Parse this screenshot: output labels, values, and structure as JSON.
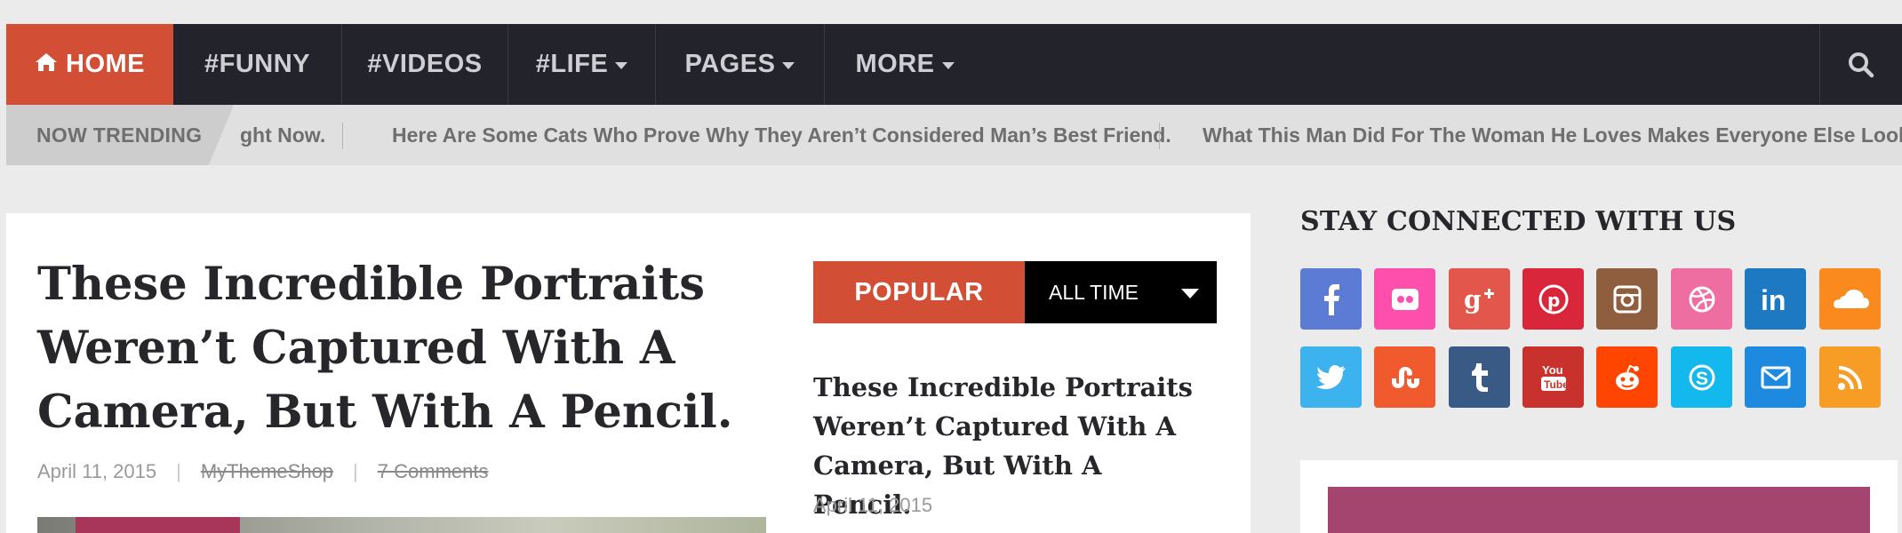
{
  "nav": {
    "home_label": "HOME",
    "items": [
      {
        "label": "#FUNNY",
        "has_caret": false
      },
      {
        "label": "#VIDEOS",
        "has_caret": false
      },
      {
        "label": "#LIFE",
        "has_caret": true
      },
      {
        "label": "PAGES",
        "has_caret": true
      },
      {
        "label": "MORE",
        "has_caret": true
      }
    ],
    "search_icon": "search-icon",
    "accent_color": "#d24e35",
    "bg_color": "#23232b"
  },
  "trending": {
    "label": "NOW TRENDING",
    "items": [
      "ght Now.",
      "Here Are Some Cats Who Prove Why They Aren’t Considered Man’s Best Friend.",
      "What This Man Did For The Woman He Loves Makes Everyone Else Look Ba"
    ]
  },
  "article": {
    "title": "These Incredible Portraits Weren’t Captured With A Camera, But With A Pencil.",
    "date": "April 11, 2015",
    "author": "MyThemeShop",
    "comments": "7 Comments"
  },
  "popular": {
    "tab_label": "POPULAR",
    "select_value": "ALL TIME",
    "post_title": "These Incredible Portraits Weren’t Captured With A Camera, But With A Pencil.",
    "post_date": "April 11, 2015"
  },
  "sidebar": {
    "heading": "STAY CONNECTED WITH US",
    "social": [
      {
        "name": "facebook-icon",
        "color": "#5b7bd5"
      },
      {
        "name": "flickr-icon",
        "color": "#ff4fad"
      },
      {
        "name": "google-plus-icon",
        "color": "#e2564b"
      },
      {
        "name": "pinterest-icon",
        "color": "#d9263a"
      },
      {
        "name": "instagram-icon",
        "color": "#8e5e3f"
      },
      {
        "name": "dribbble-icon",
        "color": "#ef6ea1"
      },
      {
        "name": "linkedin-icon",
        "color": "#1c79c2"
      },
      {
        "name": "soundcloud-icon",
        "color": "#fb8a1e"
      },
      {
        "name": "twitter-icon",
        "color": "#3cb3ee"
      },
      {
        "name": "stumbleupon-icon",
        "color": "#f05a2d"
      },
      {
        "name": "tumblr-icon",
        "color": "#3a5a86"
      },
      {
        "name": "youtube-icon",
        "color": "#c8312c"
      },
      {
        "name": "reddit-icon",
        "color": "#ff4500"
      },
      {
        "name": "skype-icon",
        "color": "#13b8ec"
      },
      {
        "name": "email-icon",
        "color": "#1d8ae0"
      },
      {
        "name": "rss-icon",
        "color": "#f79d26"
      }
    ]
  }
}
